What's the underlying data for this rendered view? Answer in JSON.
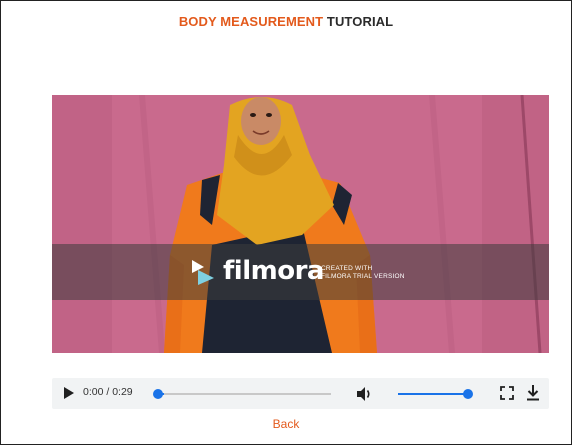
{
  "header": {
    "title_accent": "BODY MEASUREMENT",
    "title_rest": "TUTORIAL"
  },
  "video": {
    "watermark_brand": "filmora",
    "watermark_line1": "CREATED WITH",
    "watermark_line2": "FILMORA TRIAL VERSION"
  },
  "player": {
    "time": "0:00 / 0:29",
    "progress_fraction": 0.0,
    "volume_fraction": 1.0,
    "icons": [
      "play-icon",
      "volume-icon",
      "fullscreen-icon",
      "download-icon"
    ]
  },
  "footer": {
    "back_label": "Back"
  },
  "colors": {
    "accent": "#e35a1c",
    "slider": "#1a73e8",
    "backdrop": "#c96a8d"
  }
}
